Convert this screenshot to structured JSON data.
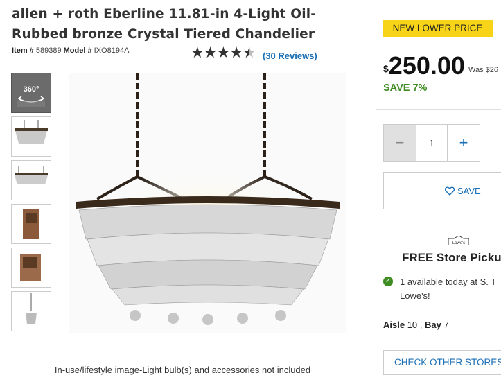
{
  "product": {
    "title": "allen + roth Eberline 11.81-in 4-Light Oil-Rubbed bronze Crystal Tiered Chandelier",
    "item_label": "Item #",
    "item_number": "589389",
    "model_label": "Model #",
    "model_number": "IXO8194A",
    "rating": 4.5,
    "reviews_text": "(30 Reviews)"
  },
  "gallery": {
    "thumb_360_label": "360°",
    "caption": "In-use/lifestyle image-Light bulb(s) and accessories not included"
  },
  "pricing": {
    "badge": "NEW LOWER PRICE",
    "currency": "$",
    "price": "250.00",
    "was": "Was $26",
    "save": "SAVE 7%"
  },
  "cart": {
    "minus": "−",
    "quantity": "1",
    "plus": "+",
    "save_label": "SAVE"
  },
  "store": {
    "logo": "Lowe's",
    "free_pickup": "FREE Store Picku",
    "availability_line1": "1 available today at S. T",
    "availability_line2": "Lowe's!",
    "aisle_label": "Aisle",
    "aisle_value": "10",
    "bay_label": "Bay",
    "bay_value": "7",
    "check_other": "CHECK OTHER STORES"
  },
  "colors": {
    "accent_blue": "#1b6fb5",
    "badge_yellow": "#f7d417",
    "save_green": "#3f8c22"
  }
}
